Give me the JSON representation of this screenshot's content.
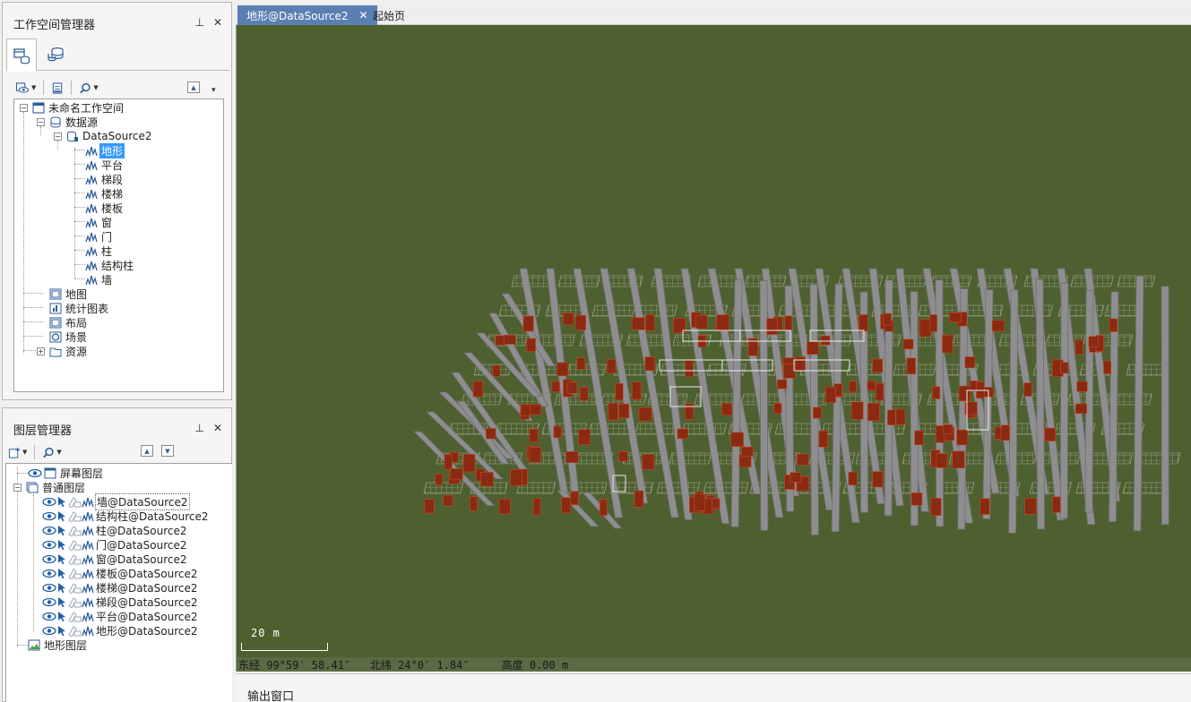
{
  "workspace_panel": {
    "title": "工作空间管理器",
    "pin": "⊥",
    "close": "✕",
    "tree": {
      "root": "未命名工作空间",
      "datasources": "数据源",
      "datasource": "DataSource2",
      "datasets": [
        "地形",
        "平台",
        "梯段",
        "楼梯",
        "楼板",
        "窗",
        "门",
        "柱",
        "结构柱",
        "墙"
      ],
      "map": "地图",
      "chart": "统计图表",
      "layout": "布局",
      "scene": "场景",
      "resources": "资源"
    }
  },
  "layer_panel": {
    "title": "图层管理器",
    "pin": "⊥",
    "close": "✕",
    "screen_layer": "屏幕图层",
    "normal_layer": "普通图层",
    "layers": [
      "墙@DataSource2",
      "结构柱@DataSource2",
      "柱@DataSource2",
      "门@DataSource2",
      "窗@DataSource2",
      "楼板@DataSource2",
      "楼梯@DataSource2",
      "梯段@DataSource2",
      "平台@DataSource2",
      "地形@DataSource2"
    ],
    "terrain_layer": "地形图层"
  },
  "doc_tabs": {
    "active": "地形@DataSource2",
    "close": "✕",
    "second": "起始页"
  },
  "scene": {
    "scale_label": "20 m",
    "status": "东经 99°59′ 58.41″   北纬 24°0′ 1.84″     高度 0.00 m"
  },
  "output": {
    "title": "输出窗口"
  },
  "colors": {
    "scene_bg": "#4e6030",
    "tab_active": "#5a7fb2",
    "selection": "#3399ff"
  }
}
